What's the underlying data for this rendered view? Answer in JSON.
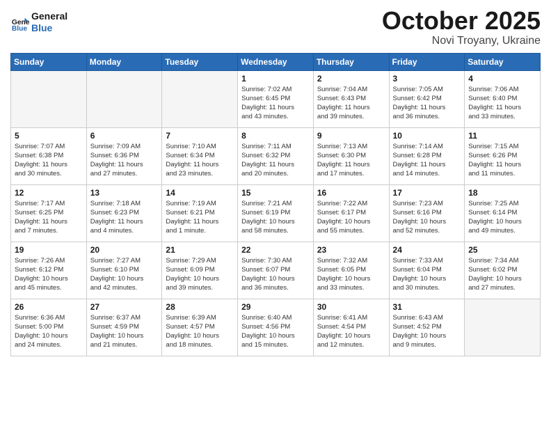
{
  "logo": {
    "text_general": "General",
    "text_blue": "Blue"
  },
  "header": {
    "month": "October 2025",
    "location": "Novi Troyany, Ukraine"
  },
  "weekdays": [
    "Sunday",
    "Monday",
    "Tuesday",
    "Wednesday",
    "Thursday",
    "Friday",
    "Saturday"
  ],
  "weeks": [
    [
      {
        "day": "",
        "info": ""
      },
      {
        "day": "",
        "info": ""
      },
      {
        "day": "",
        "info": ""
      },
      {
        "day": "1",
        "info": "Sunrise: 7:02 AM\nSunset: 6:45 PM\nDaylight: 11 hours\nand 43 minutes."
      },
      {
        "day": "2",
        "info": "Sunrise: 7:04 AM\nSunset: 6:43 PM\nDaylight: 11 hours\nand 39 minutes."
      },
      {
        "day": "3",
        "info": "Sunrise: 7:05 AM\nSunset: 6:42 PM\nDaylight: 11 hours\nand 36 minutes."
      },
      {
        "day": "4",
        "info": "Sunrise: 7:06 AM\nSunset: 6:40 PM\nDaylight: 11 hours\nand 33 minutes."
      }
    ],
    [
      {
        "day": "5",
        "info": "Sunrise: 7:07 AM\nSunset: 6:38 PM\nDaylight: 11 hours\nand 30 minutes."
      },
      {
        "day": "6",
        "info": "Sunrise: 7:09 AM\nSunset: 6:36 PM\nDaylight: 11 hours\nand 27 minutes."
      },
      {
        "day": "7",
        "info": "Sunrise: 7:10 AM\nSunset: 6:34 PM\nDaylight: 11 hours\nand 23 minutes."
      },
      {
        "day": "8",
        "info": "Sunrise: 7:11 AM\nSunset: 6:32 PM\nDaylight: 11 hours\nand 20 minutes."
      },
      {
        "day": "9",
        "info": "Sunrise: 7:13 AM\nSunset: 6:30 PM\nDaylight: 11 hours\nand 17 minutes."
      },
      {
        "day": "10",
        "info": "Sunrise: 7:14 AM\nSunset: 6:28 PM\nDaylight: 11 hours\nand 14 minutes."
      },
      {
        "day": "11",
        "info": "Sunrise: 7:15 AM\nSunset: 6:26 PM\nDaylight: 11 hours\nand 11 minutes."
      }
    ],
    [
      {
        "day": "12",
        "info": "Sunrise: 7:17 AM\nSunset: 6:25 PM\nDaylight: 11 hours\nand 7 minutes."
      },
      {
        "day": "13",
        "info": "Sunrise: 7:18 AM\nSunset: 6:23 PM\nDaylight: 11 hours\nand 4 minutes."
      },
      {
        "day": "14",
        "info": "Sunrise: 7:19 AM\nSunset: 6:21 PM\nDaylight: 11 hours\nand 1 minute."
      },
      {
        "day": "15",
        "info": "Sunrise: 7:21 AM\nSunset: 6:19 PM\nDaylight: 10 hours\nand 58 minutes."
      },
      {
        "day": "16",
        "info": "Sunrise: 7:22 AM\nSunset: 6:17 PM\nDaylight: 10 hours\nand 55 minutes."
      },
      {
        "day": "17",
        "info": "Sunrise: 7:23 AM\nSunset: 6:16 PM\nDaylight: 10 hours\nand 52 minutes."
      },
      {
        "day": "18",
        "info": "Sunrise: 7:25 AM\nSunset: 6:14 PM\nDaylight: 10 hours\nand 49 minutes."
      }
    ],
    [
      {
        "day": "19",
        "info": "Sunrise: 7:26 AM\nSunset: 6:12 PM\nDaylight: 10 hours\nand 45 minutes."
      },
      {
        "day": "20",
        "info": "Sunrise: 7:27 AM\nSunset: 6:10 PM\nDaylight: 10 hours\nand 42 minutes."
      },
      {
        "day": "21",
        "info": "Sunrise: 7:29 AM\nSunset: 6:09 PM\nDaylight: 10 hours\nand 39 minutes."
      },
      {
        "day": "22",
        "info": "Sunrise: 7:30 AM\nSunset: 6:07 PM\nDaylight: 10 hours\nand 36 minutes."
      },
      {
        "day": "23",
        "info": "Sunrise: 7:32 AM\nSunset: 6:05 PM\nDaylight: 10 hours\nand 33 minutes."
      },
      {
        "day": "24",
        "info": "Sunrise: 7:33 AM\nSunset: 6:04 PM\nDaylight: 10 hours\nand 30 minutes."
      },
      {
        "day": "25",
        "info": "Sunrise: 7:34 AM\nSunset: 6:02 PM\nDaylight: 10 hours\nand 27 minutes."
      }
    ],
    [
      {
        "day": "26",
        "info": "Sunrise: 6:36 AM\nSunset: 5:00 PM\nDaylight: 10 hours\nand 24 minutes."
      },
      {
        "day": "27",
        "info": "Sunrise: 6:37 AM\nSunset: 4:59 PM\nDaylight: 10 hours\nand 21 minutes."
      },
      {
        "day": "28",
        "info": "Sunrise: 6:39 AM\nSunset: 4:57 PM\nDaylight: 10 hours\nand 18 minutes."
      },
      {
        "day": "29",
        "info": "Sunrise: 6:40 AM\nSunset: 4:56 PM\nDaylight: 10 hours\nand 15 minutes."
      },
      {
        "day": "30",
        "info": "Sunrise: 6:41 AM\nSunset: 4:54 PM\nDaylight: 10 hours\nand 12 minutes."
      },
      {
        "day": "31",
        "info": "Sunrise: 6:43 AM\nSunset: 4:52 PM\nDaylight: 10 hours\nand 9 minutes."
      },
      {
        "day": "",
        "info": ""
      }
    ]
  ]
}
